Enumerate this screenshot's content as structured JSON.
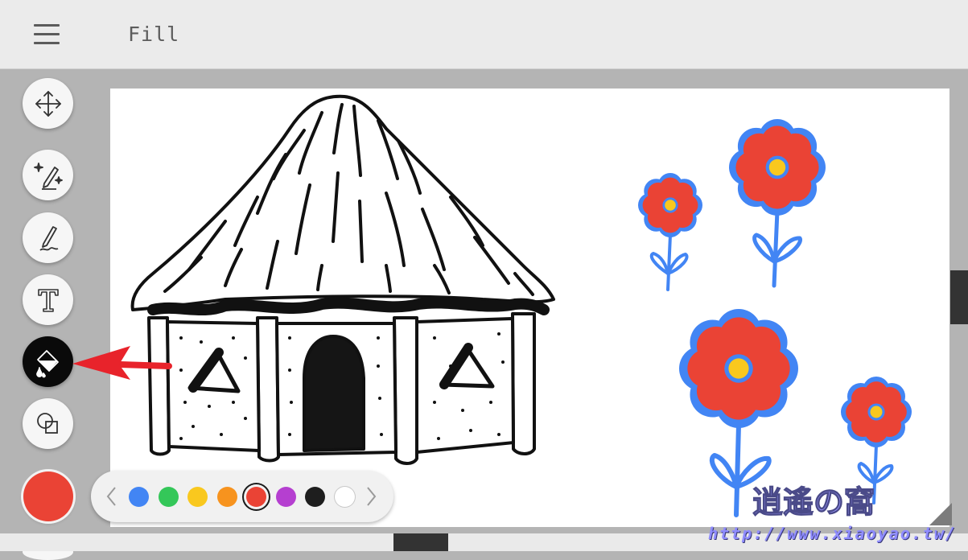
{
  "header": {
    "title": "Fill",
    "menu_icon": "hamburger-menu-icon"
  },
  "sidebar": {
    "tools": [
      {
        "name": "move",
        "icon": "move-arrows-icon",
        "active": false
      },
      {
        "name": "magic-pen",
        "icon": "sparkle-pen-icon",
        "active": false
      },
      {
        "name": "pen",
        "icon": "pen-icon",
        "active": false
      },
      {
        "name": "text",
        "icon": "text-T-icon",
        "active": false
      },
      {
        "name": "fill",
        "icon": "paint-bucket-icon",
        "active": true
      },
      {
        "name": "shapes",
        "icon": "shapes-icon",
        "active": false
      }
    ],
    "current_color": "#ea4335"
  },
  "palette": {
    "prev_icon": "chevron-left-icon",
    "next_icon": "chevron-right-icon",
    "colors": [
      "#4285f4",
      "#34c759",
      "#f9c81e",
      "#f7931e",
      "#ea4335",
      "#b53fd0",
      "#1e1e1e",
      "#ffffff"
    ],
    "selected_index": 4
  },
  "canvas": {
    "background": "#ffffff",
    "drawing": "hut and four flowers"
  },
  "annotation": {
    "arrow_color": "#e8232b",
    "points_to": "fill tool"
  },
  "watermark": {
    "logo_text": "逍遙の窩",
    "url": "http://www.xiaoyao.tw/"
  }
}
